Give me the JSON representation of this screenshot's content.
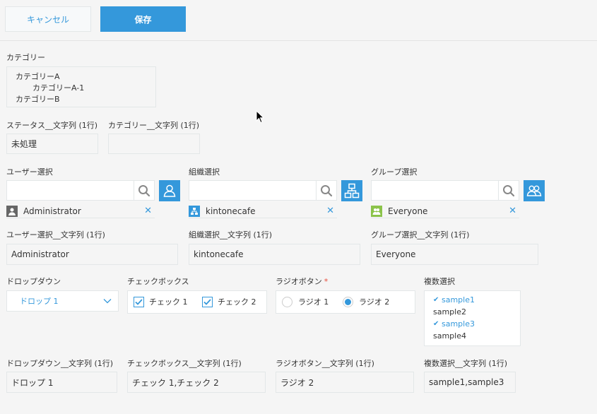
{
  "toolbar": {
    "cancel_label": "キャンセル",
    "save_label": "保存"
  },
  "category": {
    "label": "カテゴリー",
    "items": [
      "カテゴリーA",
      "カテゴリーA-1",
      "カテゴリーB"
    ]
  },
  "status_text": {
    "label": "ステータス__文字列 (1行)",
    "value": "未処理"
  },
  "category_text": {
    "label": "カテゴリー__文字列 (1行)",
    "value": ""
  },
  "user_select": {
    "label": "ユーザー選択",
    "selected": "Administrator",
    "icon": "user-icon"
  },
  "org_select": {
    "label": "組織選択",
    "selected": "kintonecafe",
    "icon": "organization-icon"
  },
  "group_select": {
    "label": "グループ選択",
    "selected": "Everyone",
    "icon": "group-icon"
  },
  "user_text": {
    "label": "ユーザー選択__文字列 (1行)",
    "value": "Administrator"
  },
  "org_text": {
    "label": "組織選択__文字列 (1行)",
    "value": "kintonecafe"
  },
  "group_text": {
    "label": "グループ選択__文字列 (1行)",
    "value": "Everyone"
  },
  "dropdown": {
    "label": "ドロップダウン",
    "value": "ドロップ 1"
  },
  "checkbox": {
    "label": "チェックボックス",
    "options": [
      {
        "label": "チェック 1",
        "checked": true
      },
      {
        "label": "チェック 2",
        "checked": true
      }
    ]
  },
  "radio": {
    "label": "ラジオボタン",
    "required_mark": "*",
    "options": [
      {
        "label": "ラジオ 1",
        "selected": false
      },
      {
        "label": "ラジオ 2",
        "selected": true
      }
    ]
  },
  "multiselect": {
    "label": "複数選択",
    "options": [
      {
        "label": "sample1",
        "selected": true
      },
      {
        "label": "sample2",
        "selected": false
      },
      {
        "label": "sample3",
        "selected": true
      },
      {
        "label": "sample4",
        "selected": false
      }
    ]
  },
  "dropdown_text": {
    "label": "ドロップダウン__文字列 (1行)",
    "value": "ドロップ 1"
  },
  "checkbox_text": {
    "label": "チェックボックス__文字列 (1行)",
    "value": "チェック 1,チェック 2"
  },
  "radio_text": {
    "label": "ラジオボタン__文字列 (1行)",
    "value": "ラジオ 2"
  },
  "multiselect_text": {
    "label": "複数選択__文字列 (1行)",
    "value": "sample1,sample3"
  },
  "colors": {
    "accent": "#3498db",
    "border": "#e3e7e8",
    "background": "#f5f5f5",
    "required": "#e74c3c"
  }
}
